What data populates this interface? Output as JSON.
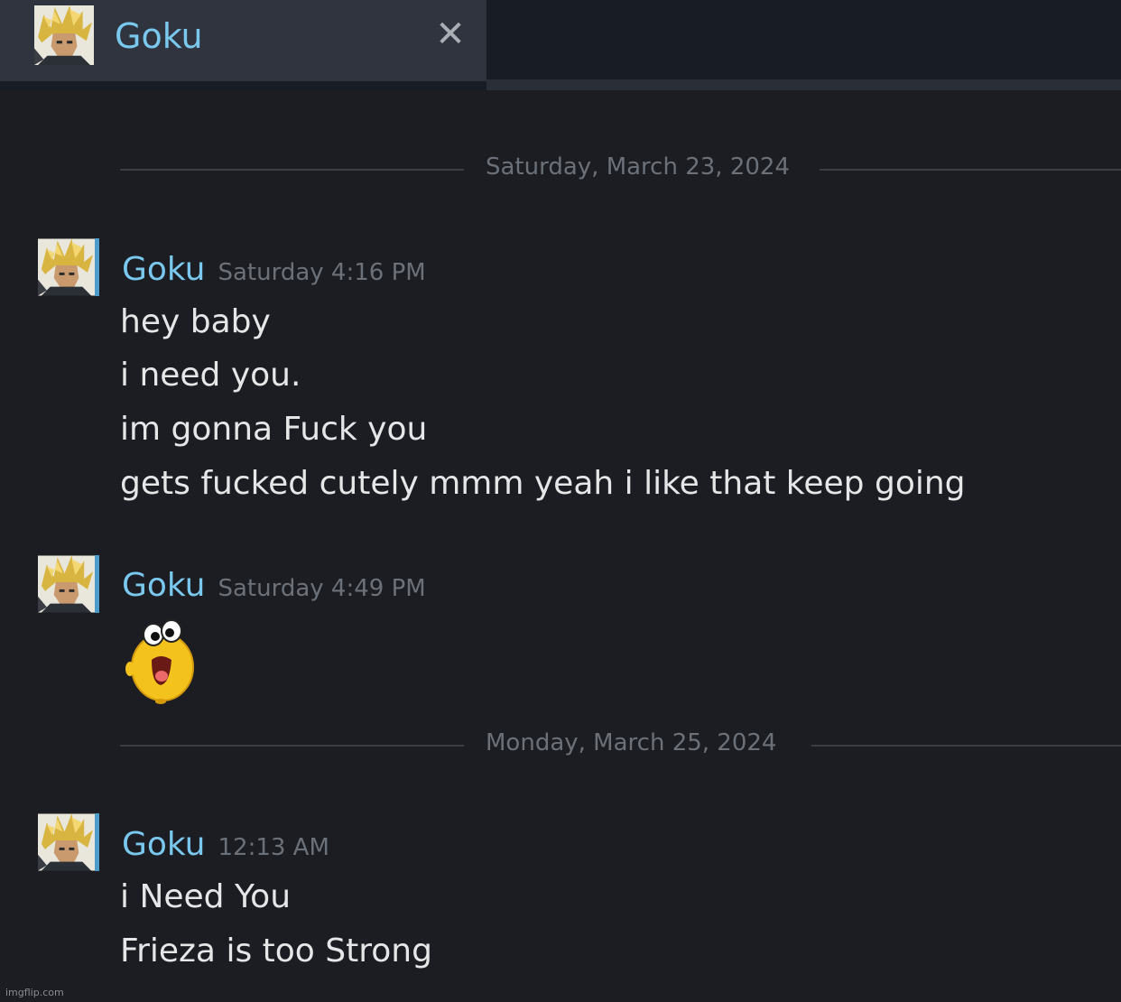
{
  "tab": {
    "title": "Goku",
    "close_symbol": "✕",
    "avatar_icon": "goku-avatar"
  },
  "dividers": [
    "Saturday, March 23, 2024",
    "Monday, March 25, 2024"
  ],
  "messages": [
    {
      "name": "Goku",
      "time": "Saturday 4:16 PM",
      "lines": [
        "hey baby",
        "i need you.",
        "im gonna Fuck you",
        "gets fucked cutely mmm yeah i like that keep going"
      ]
    },
    {
      "name": "Goku",
      "time": "Saturday 4:49 PM",
      "emoticon": "happy-yellow-blob-emoticon"
    },
    {
      "name": "Goku",
      "time": "12:13 AM",
      "lines": [
        "i Need You",
        "Frieza is too Strong"
      ]
    }
  ],
  "watermark": "imgflip.com",
  "colors": {
    "name": "#7ac8ee",
    "timestamp": "#6c7078",
    "background": "#1c1d22",
    "tab": "#2f343e"
  }
}
